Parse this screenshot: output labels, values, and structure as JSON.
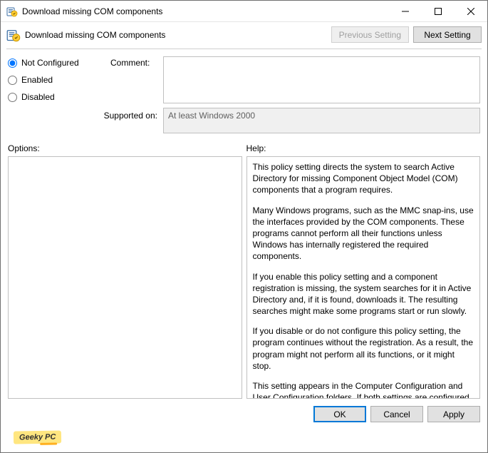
{
  "window": {
    "title": "Download missing COM components"
  },
  "header": {
    "title": "Download missing COM components",
    "previous_setting": "Previous Setting",
    "next_setting": "Next Setting"
  },
  "radios": {
    "not_configured": "Not Configured",
    "enabled": "Enabled",
    "disabled": "Disabled",
    "selected": "not_configured"
  },
  "labels": {
    "comment": "Comment:",
    "supported_on": "Supported on:",
    "options": "Options:",
    "help": "Help:"
  },
  "fields": {
    "comment_value": "",
    "supported_on_value": "At least Windows 2000"
  },
  "help_paragraphs": [
    "This policy setting directs the system to search Active Directory for missing Component Object Model (COM) components that a program requires.",
    "Many Windows programs, such as the MMC snap-ins, use the interfaces provided by the COM components. These programs cannot perform all their functions unless Windows has internally registered the required components.",
    "If you enable this policy setting and a component registration is missing, the system searches for it in Active Directory and, if it is found, downloads it. The resulting searches might make some programs start or run slowly.",
    "If you disable or do not configure this policy setting, the program continues without the registration. As a result, the program might not perform all its functions, or it might stop.",
    "This setting appears in the Computer Configuration and User Configuration folders. If both settings are configured, the setting in Computer Configuration takes precedence over the setting in User Configuration."
  ],
  "footer": {
    "ok": "OK",
    "cancel": "Cancel",
    "apply": "Apply"
  },
  "watermark": "Geeky PC"
}
